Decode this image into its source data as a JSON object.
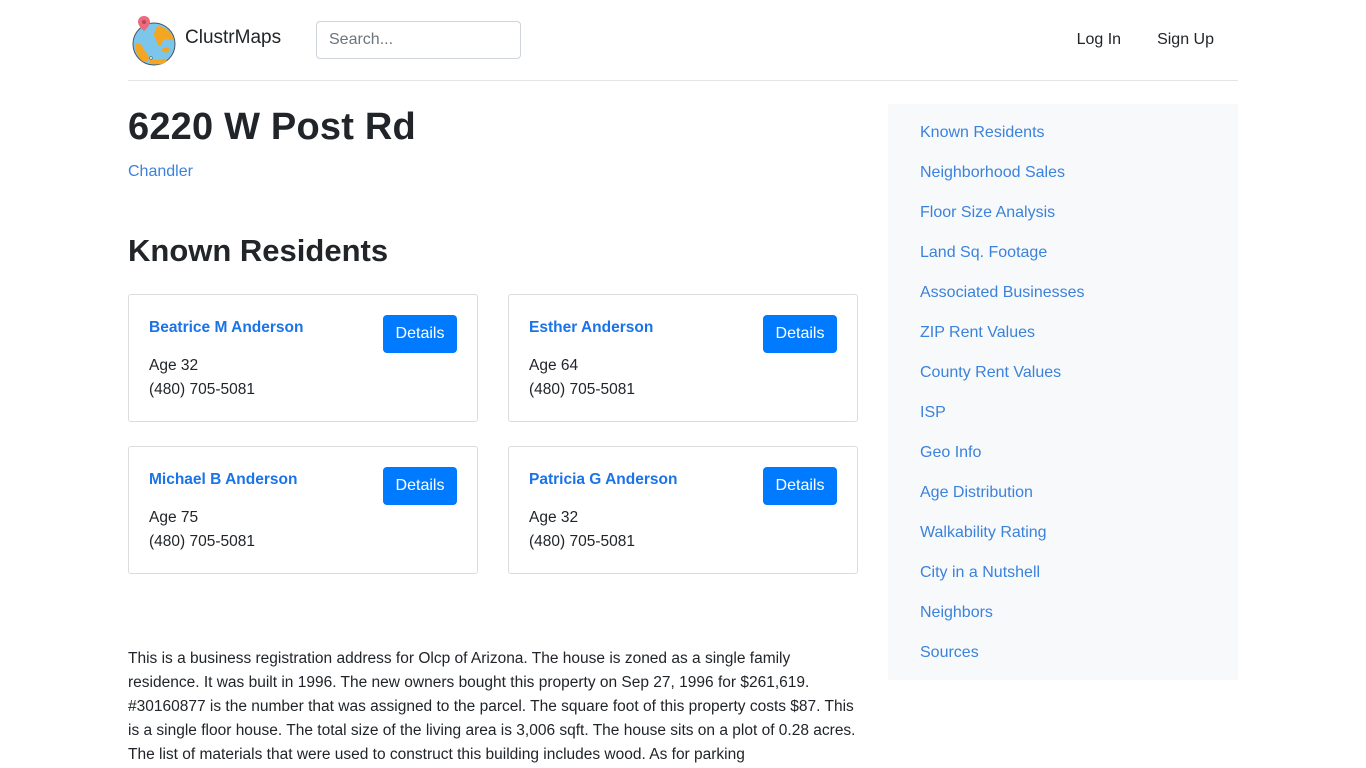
{
  "header": {
    "brand_name": "ClustrMaps",
    "logo_icon": "globe-with-pin-icon",
    "search_placeholder": "Search...",
    "search_value": "",
    "nav": [
      {
        "label": "Log In"
      },
      {
        "label": "Sign Up"
      }
    ]
  },
  "main": {
    "title": "6220 W Post Rd",
    "city_link": "Chandler",
    "residents_heading": "Known Residents",
    "residents": [
      {
        "name": "Beatrice M Anderson",
        "age": "Age 32",
        "phone": "(480) 705-5081",
        "button": "Details"
      },
      {
        "name": "Esther Anderson",
        "age": "Age 64",
        "phone": "(480) 705-5081",
        "button": "Details"
      },
      {
        "name": "Michael B Anderson",
        "age": "Age 75",
        "phone": "(480) 705-5081",
        "button": "Details"
      },
      {
        "name": "Patricia G Anderson",
        "age": "Age 32",
        "phone": "(480) 705-5081",
        "button": "Details"
      }
    ],
    "description": "This is a business registration address for Olcp of Arizona. The house is zoned as a single family residence. It was built in 1996. The new owners bought this property on Sep 27, 1996 for $261,619. #30160877 is the number that was assigned to the parcel. The square foot of this property costs $87. This is a single floor house. The total size of the living area is 3,006 sqft. The house sits on a plot of 0.28 acres. The list of materials that were used to construct this building includes wood. As for parking"
  },
  "sidebar": {
    "items": [
      {
        "label": "Known Residents"
      },
      {
        "label": "Neighborhood Sales"
      },
      {
        "label": "Floor Size Analysis"
      },
      {
        "label": "Land Sq. Footage"
      },
      {
        "label": "Associated Businesses"
      },
      {
        "label": "ZIP Rent Values"
      },
      {
        "label": "County Rent Values"
      },
      {
        "label": "ISP"
      },
      {
        "label": "Geo Info"
      },
      {
        "label": "Age Distribution"
      },
      {
        "label": "Walkability Rating"
      },
      {
        "label": "City in a Nutshell"
      },
      {
        "label": "Neighbors"
      },
      {
        "label": "Sources"
      }
    ]
  },
  "colors": {
    "link": "#3b82dc",
    "primary_button": "#007bff",
    "sidebar_bg": "#f8f9fa",
    "text": "#212529"
  }
}
